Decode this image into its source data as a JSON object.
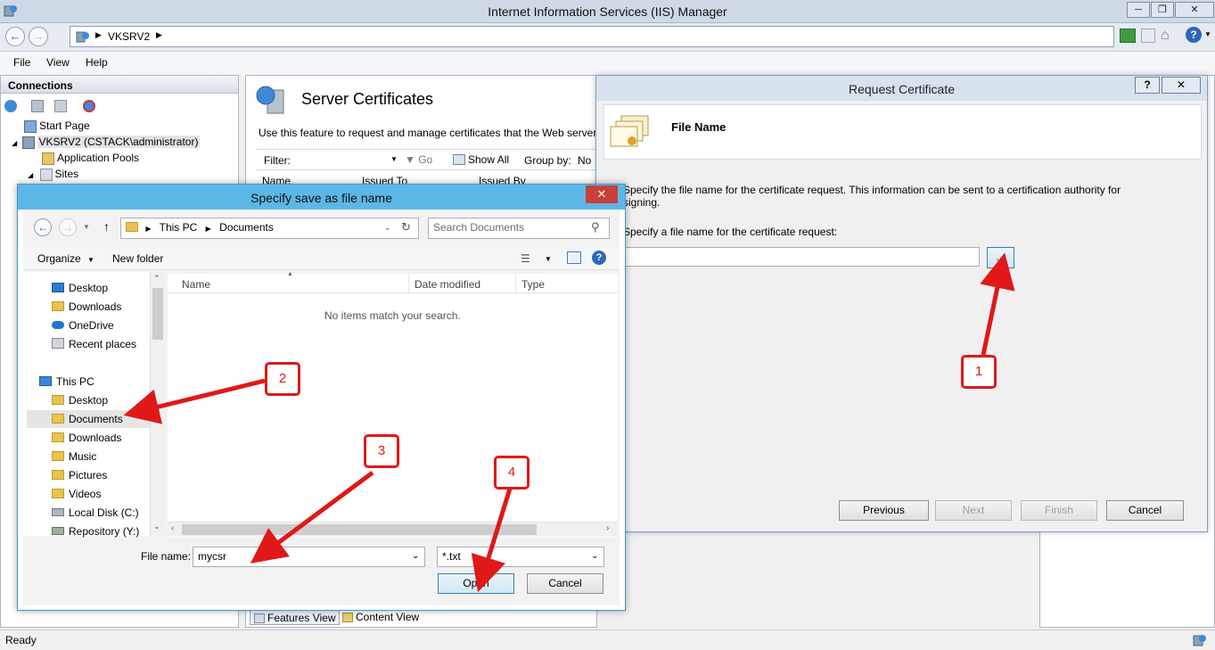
{
  "window": {
    "title": "Internet Information Services (IIS) Manager"
  },
  "address": {
    "segments": [
      "VKSRV2"
    ]
  },
  "menu": {
    "file": "File",
    "view": "View",
    "help": "Help"
  },
  "connections": {
    "header": "Connections",
    "items": [
      "Start Page",
      "VKSRV2 (CSTACK\\administrator)",
      "Application Pools",
      "Sites"
    ]
  },
  "server_certs": {
    "title": "Server Certificates",
    "description": "Use this feature to request and manage certificates that the Web server c",
    "filter_label": "Filter:",
    "go_label": "Go",
    "show_all_label": "Show All",
    "group_by_label": "Group by:",
    "group_by_value": "No",
    "columns": [
      "Name",
      "Issued To",
      "Issued By"
    ],
    "features_view": "Features View",
    "content_view": "Content View"
  },
  "request_cert": {
    "title": "Request Certificate",
    "header": "File Name",
    "description": "Specify the file name for the certificate request. This information can be sent to a certification authority for signing.",
    "prompt": "Specify a file name for the certificate request:",
    "browse_label": "...",
    "buttons": {
      "previous": "Previous",
      "next": "Next",
      "finish": "Finish",
      "cancel": "Cancel"
    },
    "help_label": "?",
    "close_label": "✕"
  },
  "save_dialog": {
    "title": "Specify save as file name",
    "breadcrumb": [
      "This PC",
      "Documents"
    ],
    "search_placeholder": "Search Documents",
    "organize_label": "Organize",
    "new_folder_label": "New folder",
    "nav_items": {
      "desktop": "Desktop",
      "downloads": "Downloads",
      "onedrive": "OneDrive",
      "recent": "Recent places",
      "this_pc": "This PC",
      "pc_desktop": "Desktop",
      "documents": "Documents",
      "pc_downloads": "Downloads",
      "music": "Music",
      "pictures": "Pictures",
      "videos": "Videos",
      "local_disk": "Local Disk (C:)",
      "repository": "Repository (Y:)"
    },
    "columns": [
      "Name",
      "Date modified",
      "Type"
    ],
    "empty_text": "No items match your search.",
    "file_name_label": "File name:",
    "file_name_value": "mycsr",
    "file_type_value": "*.txt",
    "open_label": "Open",
    "cancel_label": "Cancel"
  },
  "callouts": [
    "1",
    "2",
    "3",
    "4"
  ],
  "status": {
    "text": "Ready"
  },
  "colors": {
    "callout": "#e01818",
    "dialog_title": "#5cb7e6",
    "close": "#c7403a"
  }
}
